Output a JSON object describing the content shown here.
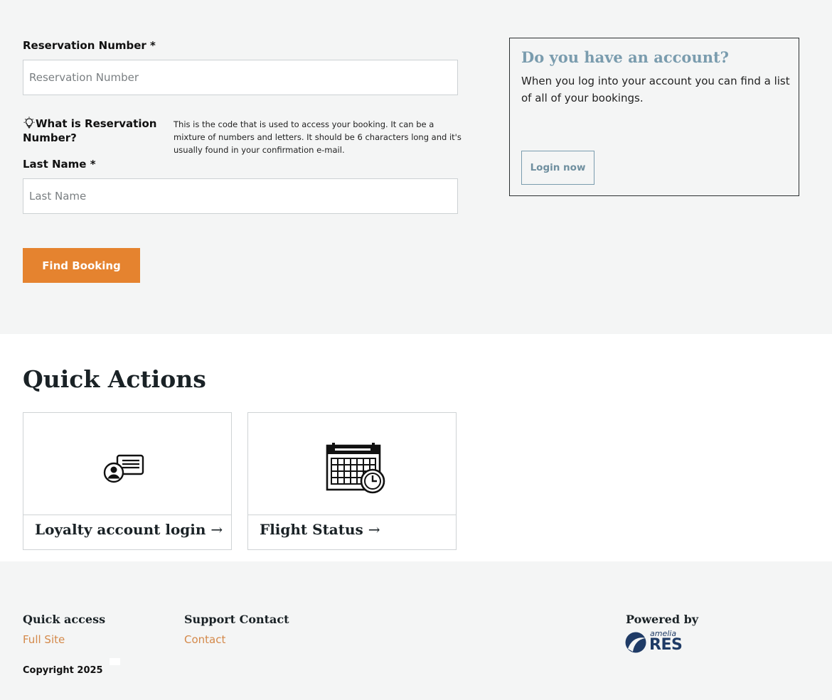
{
  "form": {
    "reservation_label": "Reservation Number *",
    "reservation_placeholder": "Reservation Number",
    "help_title": "What is Reservation Number?",
    "help_text": "This is the code that is used to access your booking. It can be a mixture of numbers and letters. It should be 6 characters long and it's usually found in your confirmation e-mail.",
    "lastname_label": "Last Name *",
    "lastname_placeholder": "Last Name",
    "find_button": "Find Booking"
  },
  "account_box": {
    "title": "Do you have an account?",
    "text": "When you log into your account you can find a list of all of your bookings.",
    "login_button": "Login now"
  },
  "quick_actions": {
    "title": "Quick Actions",
    "cards": [
      {
        "label": "Loyalty account login",
        "icon": "loyalty-card-icon"
      },
      {
        "label": "Flight Status",
        "icon": "calendar-clock-icon"
      }
    ],
    "arrow": "→"
  },
  "footer": {
    "quick_access_heading": "Quick access",
    "full_site_link": "Full Site",
    "support_heading": "Support Contact",
    "contact_link": "Contact",
    "powered_by": "Powered by",
    "logo_small": "amelia",
    "logo_big": "RES",
    "copyright": "Copyright 2025"
  },
  "colors": {
    "accent_orange": "#e5832f",
    "accent_blue": "#7a9cae",
    "link_orange": "#d4894a",
    "logo_navy": "#1f3b66"
  }
}
